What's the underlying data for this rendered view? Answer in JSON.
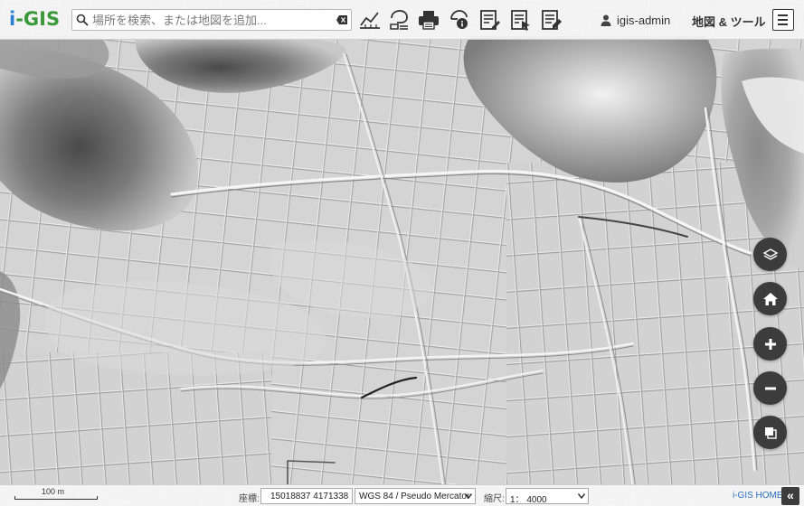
{
  "app": {
    "logo_i": "i",
    "logo_rest": "-GIS"
  },
  "search": {
    "placeholder": "場所を検索、または地図を追加..."
  },
  "toolbar": {
    "icons": [
      "profile-chart-icon",
      "identify-icon",
      "print-icon",
      "timeline-info-icon",
      "edit-attributes-icon",
      "select-edit-icon",
      "report-icon"
    ]
  },
  "user": {
    "name": "igis-admin"
  },
  "map_tools": {
    "label": "地図 & ツール"
  },
  "controls": [
    "layers-icon",
    "home-icon",
    "zoom-in-icon",
    "zoom-out-icon",
    "basemap-icon"
  ],
  "footer": {
    "scale_bar_label": "100 m",
    "coord_label": "座標:",
    "coord_value": "15018837 4171338",
    "crs": "WGS 84 / Pseudo Mercator",
    "scale_label": "縮尺:",
    "scale_value": "1： 4000",
    "home_link": "i-GIS HOME",
    "collapse": "«"
  },
  "colors": {
    "accent_blue": "#2a7fd0",
    "accent_green": "#3a9a3a",
    "control_bg": "#3c3c3c"
  }
}
